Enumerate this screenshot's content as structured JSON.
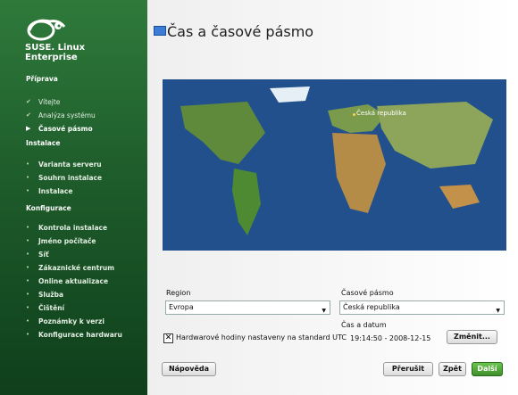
{
  "brand": {
    "line1": "SUSE. Linux",
    "line2": "Enterprise"
  },
  "sidebar": {
    "sections": [
      {
        "name": "Příprava",
        "items": [
          "Vítejte",
          "Analýza systému",
          "Časové pásmo"
        ]
      },
      {
        "name": "Instalace",
        "items": [
          "Varianta serveru",
          "Souhrn instalace",
          "Instalace"
        ]
      },
      {
        "name": "Konfigurace",
        "items": [
          "Kontrola instalace",
          "Jméno počítače",
          "Síť",
          "Zákaznické centrum",
          "Online aktualizace",
          "Služba",
          "Čištění",
          "Poznámky k verzi",
          "Konfigurace hardwaru"
        ]
      }
    ]
  },
  "title": "Čas a časové pásmo",
  "map": {
    "selected_label": "Česká republika"
  },
  "region": {
    "label": "Region",
    "value": "Evropa"
  },
  "timezone": {
    "label": "Časové pásmo",
    "value": "Česká republika"
  },
  "hardware_clock": {
    "label": "Hardwarové hodiny nastaveny na standard UTC",
    "checked": true
  },
  "time_date": {
    "label": "Čas a datum",
    "value": "19:14:50 - 2008-12-15"
  },
  "buttons": {
    "change": "Změnit...",
    "help": "Nápověda",
    "abort": "Přerušit",
    "back": "Zpět",
    "next": "Další"
  },
  "colors": {
    "sidebar": "#1e5c2b",
    "accent": "#4aa43a"
  }
}
